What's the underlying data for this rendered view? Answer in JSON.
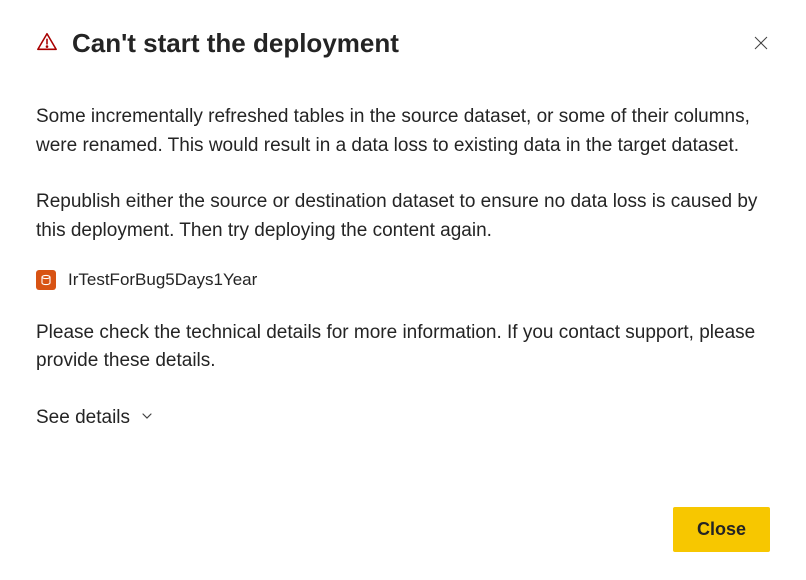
{
  "dialog": {
    "title": "Can't start the deployment",
    "paragraph1": "Some incrementally refreshed tables in the source dataset, or some of their columns, were renamed. This would result in a data loss to existing data in the target dataset.",
    "paragraph2": "Republish either the source or destination dataset to ensure no data loss is caused by this deployment. Then try deploying the content again.",
    "paragraph3": "Please check the technical details for more information. If you contact support, please provide these details.",
    "dataset_name": "IrTestForBug5Days1Year",
    "see_details_label": "See details",
    "close_button_label": "Close"
  }
}
